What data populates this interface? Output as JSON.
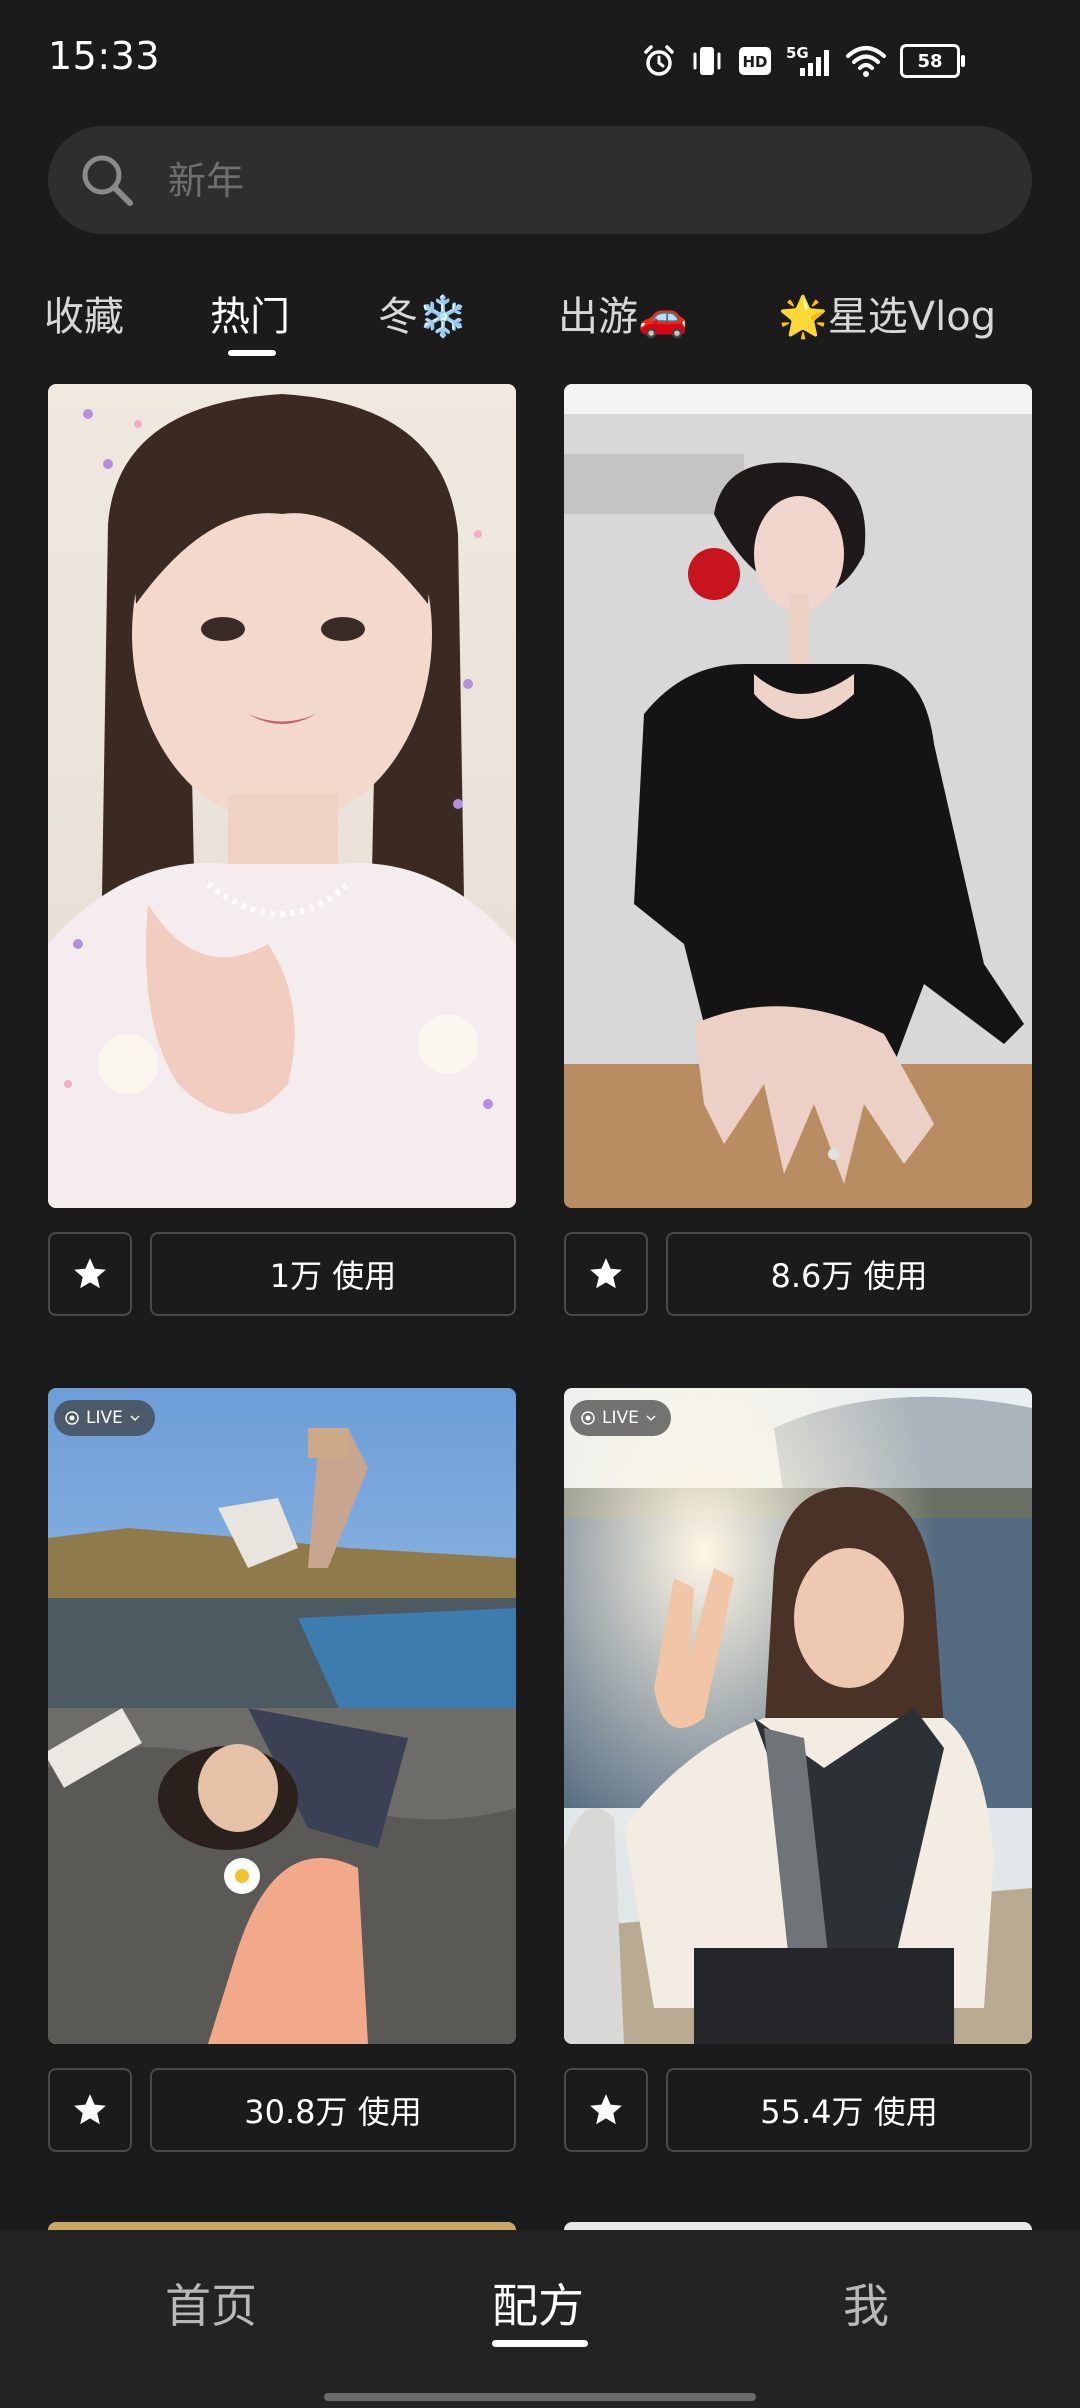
{
  "status_bar": {
    "time": "15:33",
    "network": "5G",
    "hd": "HD",
    "battery": "58",
    "icons": [
      "alarm-icon",
      "vibrate-icon",
      "hd-icon",
      "5g-signal-icon",
      "wifi-icon",
      "battery-icon"
    ]
  },
  "search": {
    "placeholder": "新年",
    "icon": "search-icon"
  },
  "tabs": [
    {
      "label": "收藏",
      "active": false
    },
    {
      "label": "热门",
      "active": true
    },
    {
      "label": "冬❄️",
      "active": false
    },
    {
      "label": "出游🚗",
      "active": false
    },
    {
      "label": "🌟星选Vlog",
      "active": false
    }
  ],
  "cards": [
    {
      "usage": "1万 使用",
      "live": false
    },
    {
      "usage": "8.6万 使用",
      "live": false
    },
    {
      "usage": "30.8万 使用",
      "live": true,
      "live_label": "LIVE"
    },
    {
      "usage": "55.4万 使用",
      "live": true,
      "live_label": "LIVE"
    }
  ],
  "bottom_nav": [
    {
      "label": "首页",
      "active": false
    },
    {
      "label": "配方",
      "active": true
    },
    {
      "label": "我",
      "active": false
    }
  ],
  "colors": {
    "background": "#1b1b1b",
    "search_bg": "#2e2e2e",
    "button_border": "#4a4a4a",
    "nav_bg": "#232323"
  }
}
